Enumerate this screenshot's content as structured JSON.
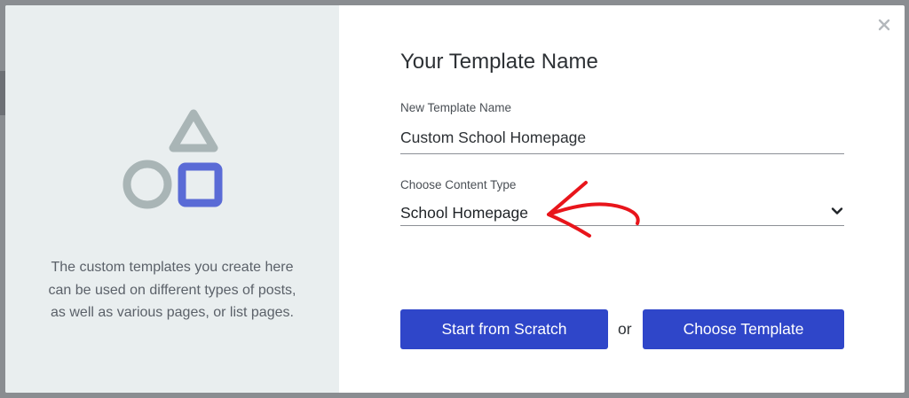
{
  "modal": {
    "title": "Your Template Name",
    "description": "The custom templates you create here can be used on different types of posts, as well as various pages, or list pages.",
    "close_icon": "close-icon"
  },
  "form": {
    "name_label": "New Template Name",
    "name_value": "Custom School Homepage",
    "type_label": "Choose Content Type",
    "type_value": "School Homepage"
  },
  "actions": {
    "scratch_label": "Start from Scratch",
    "or_text": "or",
    "template_label": "Choose Template"
  },
  "colors": {
    "primary": "#2f46c9",
    "shape_gray": "#a9b5b6",
    "shape_blue": "#5a6bd6",
    "annotation_red": "#e8151b"
  },
  "icons": {
    "shapes": "shapes-illustration-icon",
    "chevron": "chevron-down-icon"
  }
}
